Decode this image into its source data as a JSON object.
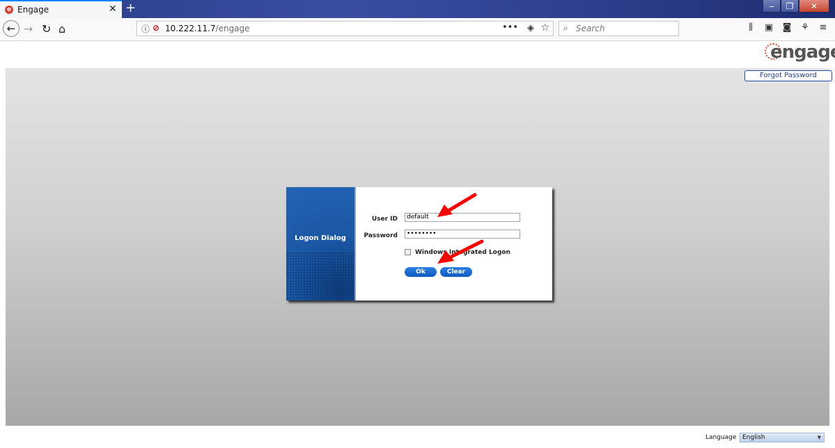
{
  "browser": {
    "tab_title": "Engage",
    "tab_close": "✕",
    "new_tab": "+",
    "url_host": "10.222.11.7",
    "url_path": "/engage",
    "url_more": "•••",
    "search_placeholder": "Search",
    "window_controls": [
      "‒",
      "❐",
      "✕"
    ]
  },
  "page": {
    "logo_text": "engage",
    "forgot_password": "Forgot Password",
    "dialog": {
      "title": "Logon Dialog",
      "user_id_label": "User ID",
      "user_id_value": "default",
      "password_label": "Password",
      "password_value": "••••••••",
      "windows_logon_label": "Windows Integrated Logon",
      "ok_button": "Ok",
      "clear_button": "Clear"
    },
    "language_label": "Language",
    "language_value": "English"
  },
  "colors": {
    "accent": "#1f5fbf",
    "dialog_sidebar": "#1a57a4",
    "annotation_arrow": "#ff0000"
  }
}
